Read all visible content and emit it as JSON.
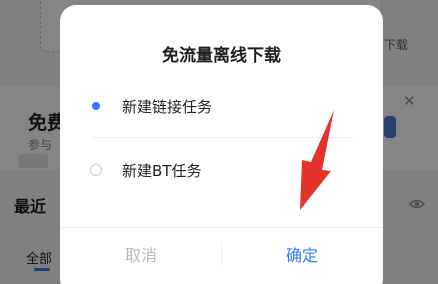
{
  "background": {
    "download_label": "下载",
    "promo_title": "免费",
    "promo_subtitle": "参与",
    "recent_label": "最近",
    "tab_all": "全部"
  },
  "dialog": {
    "title": "免流量离线下载",
    "options": [
      {
        "label": "新建链接任务",
        "selected": true
      },
      {
        "label": "新建BT任务",
        "selected": false
      }
    ],
    "cancel_label": "取消",
    "confirm_label": "确定"
  },
  "colors": {
    "accent": "#2f7bff",
    "annotation_arrow": "#e5322b"
  }
}
